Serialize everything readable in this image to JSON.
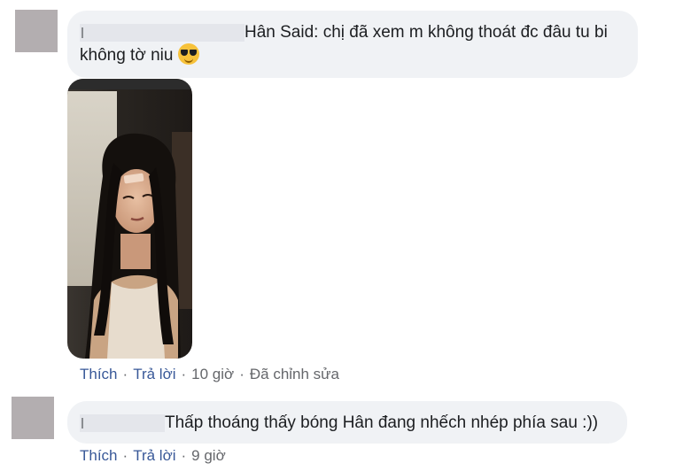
{
  "comments": [
    {
      "author_suffix": "Hân Said:",
      "text_line1": " chị đã xem m không thoát đc đâu tu bi",
      "text_line2": "không tờ niu",
      "emoji": "sunglasses-emoji",
      "actions": {
        "like": "Thích",
        "reply": "Trả lời",
        "time": "10 giờ",
        "edited": "Đã chỉnh sửa"
      }
    },
    {
      "text": "Thấp thoáng thấy bóng Hân đang nhếch nhép phía sau :))",
      "actions": {
        "like": "Thích",
        "reply": "Trả lời",
        "time": "9 giờ"
      }
    }
  ],
  "separator": "·",
  "colors": {
    "bubble": "#f0f2f5",
    "link": "#385898",
    "meta": "#65676b",
    "avatar": "#b3aeb0"
  }
}
